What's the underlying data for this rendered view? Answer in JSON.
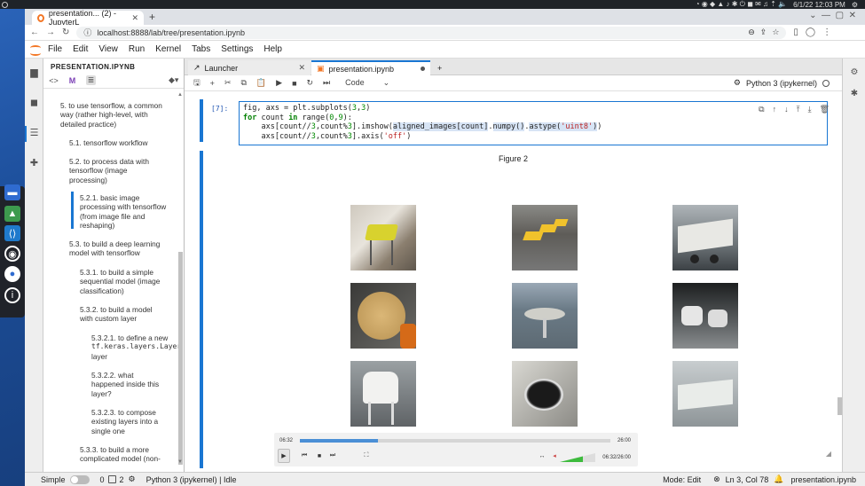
{
  "system": {
    "datetime": "6/1/22  12:03 PM"
  },
  "browser": {
    "tab_title": "presentation... (2) - JupyterL",
    "new_tab": "+",
    "url": "localhost:8888/lab/tree/presentation.ipynb"
  },
  "jupyter_menu": [
    "File",
    "Edit",
    "View",
    "Run",
    "Kernel",
    "Tabs",
    "Settings",
    "Help"
  ],
  "toc": {
    "title": "PRESENTATION.IPYNB",
    "items": [
      {
        "lines": [
          "5. to use tensorflow, a common",
          "way (rather high-level, with",
          "detailed practice)"
        ]
      },
      {
        "lines": [
          "5.1. tensorflow workflow"
        ]
      },
      {
        "lines": [
          "5.2. to process data with",
          "tensorflow (image",
          "processing)"
        ]
      },
      {
        "lines": [
          "5.2.1. basic image",
          "processing with tensorflow",
          "(from image file and",
          "reshaping)"
        ]
      },
      {
        "lines": [
          "5.3. to build a deep learning",
          "model with tensorflow"
        ]
      },
      {
        "lines": [
          "5.3.1. to build a simple",
          "sequential model (image",
          "classification)"
        ]
      },
      {
        "lines": [
          "5.3.2. to build a model",
          "with custom layer"
        ]
      },
      {
        "lines": [
          "5.3.2.1. to define a new",
          "tf.keras.layers.Layer",
          "layer"
        ]
      },
      {
        "lines": [
          "5.3.2.2. what",
          "happened inside this",
          "layer?"
        ]
      },
      {
        "lines": [
          "5.3.2.3. to compose",
          "existing layers into a",
          "single one"
        ]
      },
      {
        "lines": [
          "5.3.3. to build a more",
          "complicated model (non-"
        ]
      }
    ]
  },
  "notebook_tabs": [
    {
      "label": "Launcher"
    },
    {
      "label": "presentation.ipynb"
    }
  ],
  "toolbar": {
    "cell_type": "Code",
    "kernel": "Python 3 (ipykernel)"
  },
  "cell": {
    "prompt": "[7]:",
    "code": [
      "fig, axs = plt.subplots(3,3)",
      "for count in range(0,9):",
      "    axs[count//3,count%3].imshow(aligned_images[count].numpy().astype('uint8'))",
      "    axs[count//3,count%3].axis('off')"
    ]
  },
  "figure": {
    "title": "Figure 2"
  },
  "video": {
    "current": "06:32",
    "duration": "26:00",
    "time_display": "06:32/26:00",
    "progress": 0.25
  },
  "statusbar": {
    "simple": "Simple",
    "count_a": "0",
    "count_b": "2",
    "kernel_status": "Python 3 (ipykernel) | Idle",
    "mode": "Mode: Edit",
    "position": "Ln 3, Col 78",
    "file": "presentation.ipynb"
  }
}
